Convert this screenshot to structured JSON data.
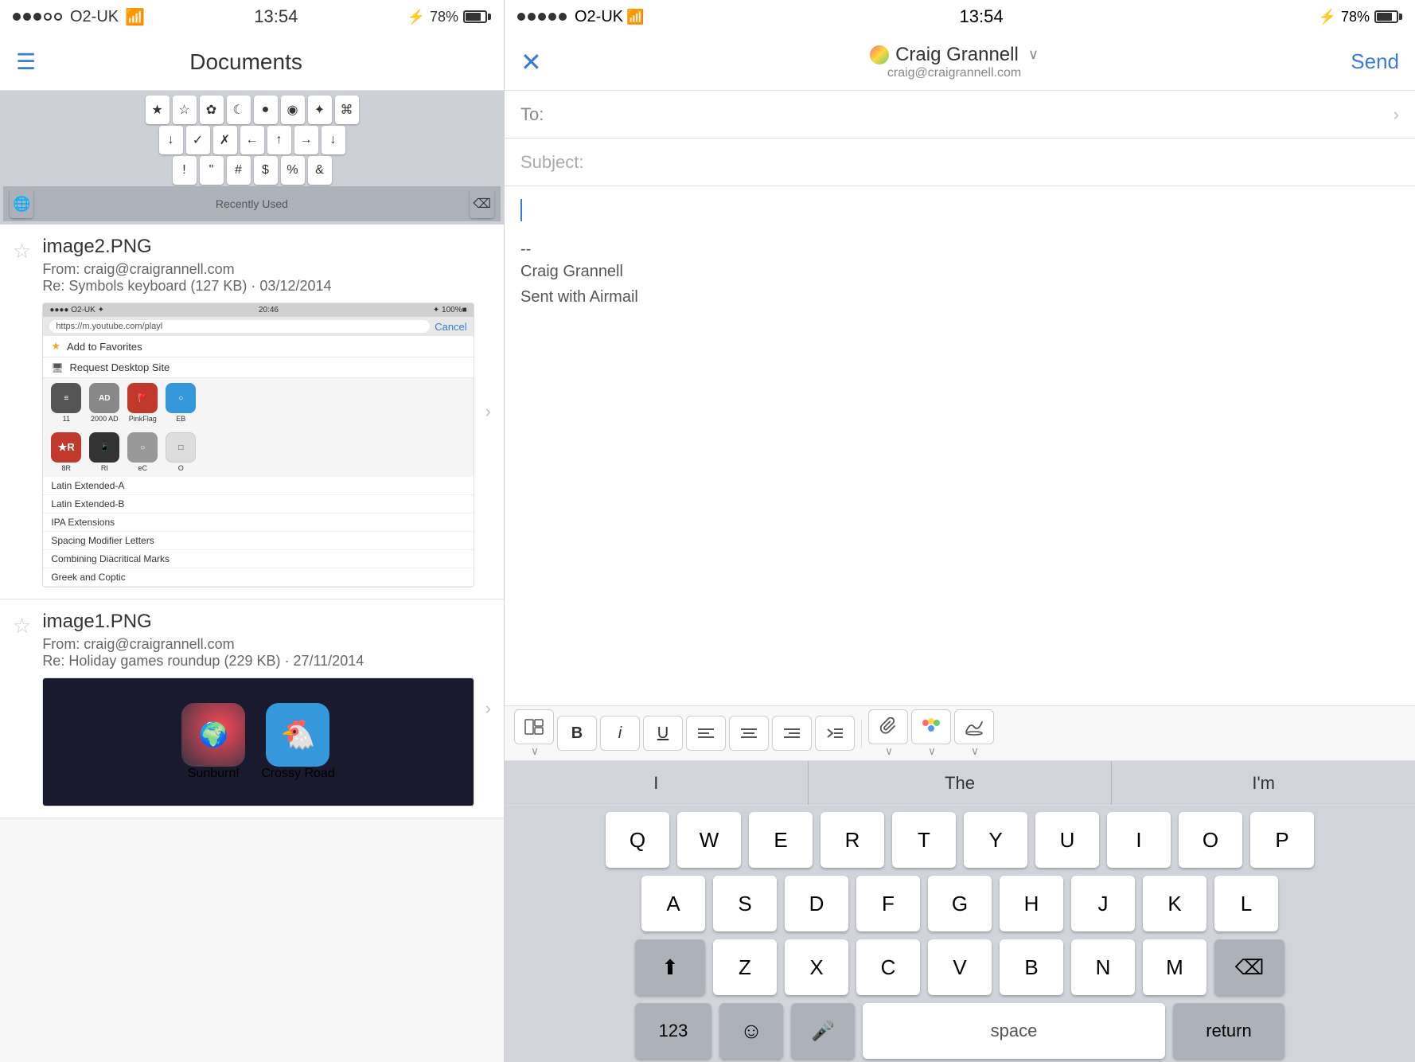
{
  "left": {
    "status_bar": {
      "carrier": "O2-UK",
      "time": "13:54",
      "battery_pct": "78%"
    },
    "nav": {
      "title": "Documents"
    },
    "keyboard_row1": [
      "★",
      "☆",
      "✿",
      "☾",
      "●",
      "◉",
      "✦",
      "⌘"
    ],
    "keyboard_row2": [
      "↓",
      "✓",
      "✗",
      "←",
      "↑",
      "→",
      "↓"
    ],
    "keyboard_row3": [
      "!",
      "\"",
      "#",
      "$",
      "%",
      "&"
    ],
    "keyboard_recently_used": "Recently Used",
    "docs": [
      {
        "title": "image2.PNG",
        "from": "From: craig@craigrannell.com",
        "subject": "Re: Symbols keyboard (127 KB) · 03/12/2014"
      },
      {
        "title": "image1.PNG",
        "from": "From: craig@craigrannell.com",
        "subject": "Re: Holiday games roundup (229 KB) · 27/11/2014"
      }
    ],
    "preview": {
      "url": "https://m.youtube.com/playl",
      "cancel": "Cancel",
      "add_to_favorites": "Add to Favorites",
      "request_desktop": "Request Desktop Site",
      "app_icons": [
        {
          "label": "11",
          "bg": "#555"
        },
        {
          "label": "2000 AD",
          "bg": "#888"
        },
        {
          "label": "PinkFlag",
          "bg": "#c0392b"
        },
        {
          "label": "EB",
          "bg": "#3498db"
        }
      ],
      "app_icons_row2": [
        {
          "label": "8R",
          "bg": "#c0392b",
          "text": "★R"
        },
        {
          "label": "RI",
          "bg": "#333"
        },
        {
          "label": "eC",
          "bg": "#555"
        },
        {
          "label": "O",
          "bg": "#ddd"
        }
      ],
      "list_items": [
        "Latin Extended-A",
        "Latin Extended-B",
        "IPA Extensions",
        "Spacing Modifier Letters",
        "Combining Diacritical Marks",
        "Greek and Coptic"
      ]
    },
    "game_icons": [
      {
        "label": "Sunburn!",
        "bg": "#e74c3c"
      },
      {
        "label": "Crossy Road",
        "bg": "#3498db"
      }
    ]
  },
  "right": {
    "status_bar": {
      "carrier": "O2-UK",
      "time": "13:54",
      "battery_pct": "78%"
    },
    "compose": {
      "close_label": "✕",
      "sender_name": "Craig Grannell",
      "sender_email": "craig@craigrannell.com",
      "send_label": "Send",
      "to_label": "To:",
      "subject_placeholder": "Subject:",
      "signature_dashes": "--",
      "signature_name": "Craig Grannell",
      "signature_app": "Sent with Airmail"
    },
    "toolbar": {
      "buttons": [
        "⊞",
        "B",
        "i",
        "U",
        "≡",
        "≡",
        "≡",
        "⊳",
        "📎",
        "🌸",
        "🎭"
      ]
    },
    "autocomplete": {
      "items": [
        "I",
        "The",
        "I'm"
      ]
    },
    "keyboard": {
      "row1": [
        "Q",
        "W",
        "E",
        "R",
        "T",
        "Y",
        "U",
        "I",
        "O",
        "P"
      ],
      "row2": [
        "A",
        "S",
        "D",
        "F",
        "G",
        "H",
        "J",
        "K",
        "L"
      ],
      "row3": [
        "Z",
        "X",
        "C",
        "V",
        "B",
        "N",
        "M"
      ],
      "shift_label": "⬆",
      "backspace_label": "⌫",
      "num_label": "123",
      "emoji_label": "☺",
      "mic_label": "🎤",
      "space_label": "space",
      "return_label": "return"
    }
  }
}
